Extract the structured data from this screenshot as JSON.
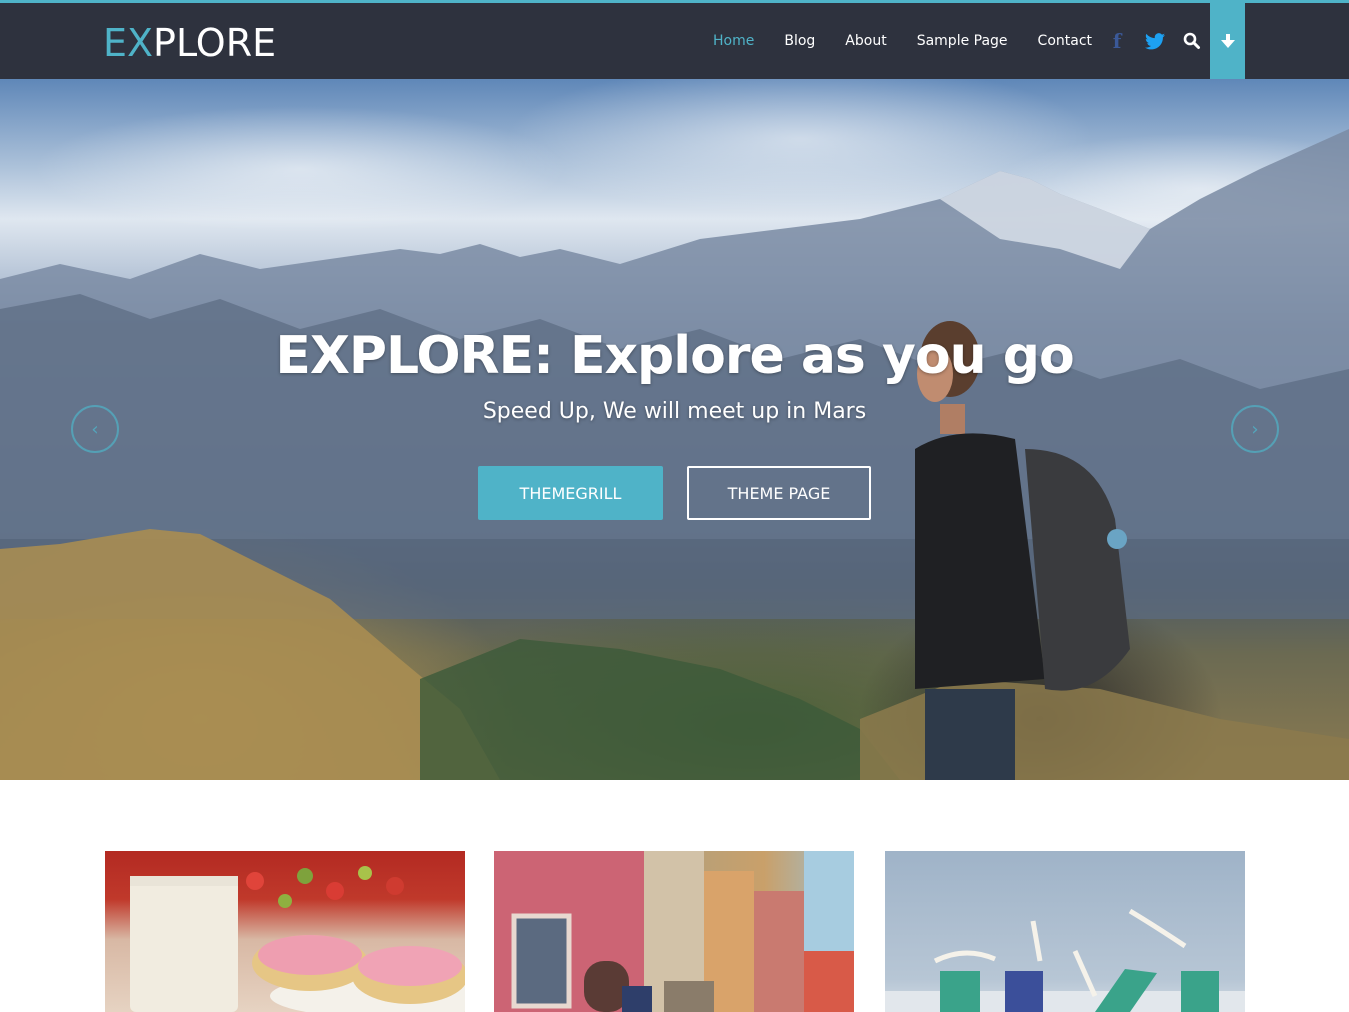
{
  "header": {
    "logo_accent": "EX",
    "logo_rest": "PLORE",
    "nav": [
      {
        "label": "Home",
        "active": true
      },
      {
        "label": "Blog",
        "active": false
      },
      {
        "label": "About",
        "active": false
      },
      {
        "label": "Sample Page",
        "active": false
      },
      {
        "label": "Contact",
        "active": false
      }
    ],
    "social_icons": [
      "facebook-icon",
      "twitter-icon"
    ],
    "search_icon": "search-icon",
    "toggle_icon": "arrow-down-icon"
  },
  "hero": {
    "title": "EXPLORE: Explore as you go",
    "subtitle": "Speed Up, We will meet up in Mars",
    "primary_button": "THEMEGRILL",
    "secondary_button": "THEME PAGE",
    "prev_icon": "‹",
    "next_icon": "›"
  },
  "cards": [
    {
      "image": "milk-and-cookies"
    },
    {
      "image": "colorful-old-town-street"
    },
    {
      "image": "beach-chairs-and-seagulls"
    }
  ],
  "colors": {
    "accent": "#4fb3c8",
    "header_bg": "#2e323e",
    "facebook": "#3b5998",
    "twitter": "#1da1f2"
  }
}
